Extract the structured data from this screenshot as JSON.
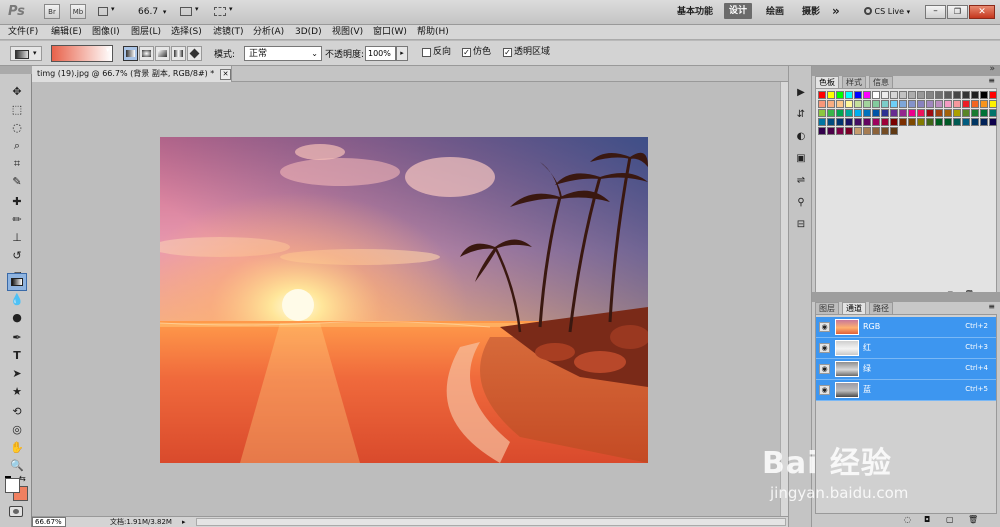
{
  "appbar": {
    "logo": "Ps",
    "br": "Br",
    "mb": "Mb",
    "zoom": "66.7",
    "workspaces": [
      "基本功能",
      "设计",
      "绘画",
      "摄影"
    ],
    "active_workspace": "设计",
    "more": "»",
    "cs_live": "CS Live"
  },
  "menubar": [
    "文件(F)",
    "编辑(E)",
    "图像(I)",
    "图层(L)",
    "选择(S)",
    "滤镜(T)",
    "分析(A)",
    "3D(D)",
    "视图(V)",
    "窗口(W)",
    "帮助(H)"
  ],
  "options": {
    "mode_label": "模式:",
    "mode_value": "正常",
    "opacity_label": "不透明度:",
    "opacity_value": "100%",
    "reverse_label": "反向",
    "dither_label": "仿色",
    "transparency_label": "透明区域",
    "reverse_checked": false,
    "dither_checked": true,
    "transparency_checked": true,
    "gradient_colors": [
      "#e8624a",
      "#ffffff"
    ]
  },
  "document": {
    "tab_title": "timg (19).jpg @ 66.7% (背景 副本, RGB/8#) *"
  },
  "status": {
    "zoom": "66.67%",
    "doc_size": "文档:1.91M/3.82M"
  },
  "swatch_panel": {
    "tabs": [
      "色板",
      "样式",
      "信息"
    ],
    "active": "色板"
  },
  "channels_panel": {
    "tabs": [
      "图层",
      "通道",
      "路径"
    ],
    "active": "通道",
    "channels": [
      {
        "name": "RGB",
        "shortcut": "Ctrl+2"
      },
      {
        "name": "红",
        "shortcut": "Ctrl+3"
      },
      {
        "name": "绿",
        "shortcut": "Ctrl+4"
      },
      {
        "name": "蓝",
        "shortcut": "Ctrl+5"
      }
    ]
  },
  "watermark": {
    "logo": "Bai 经验",
    "url": "jingyan.baidu.com"
  }
}
